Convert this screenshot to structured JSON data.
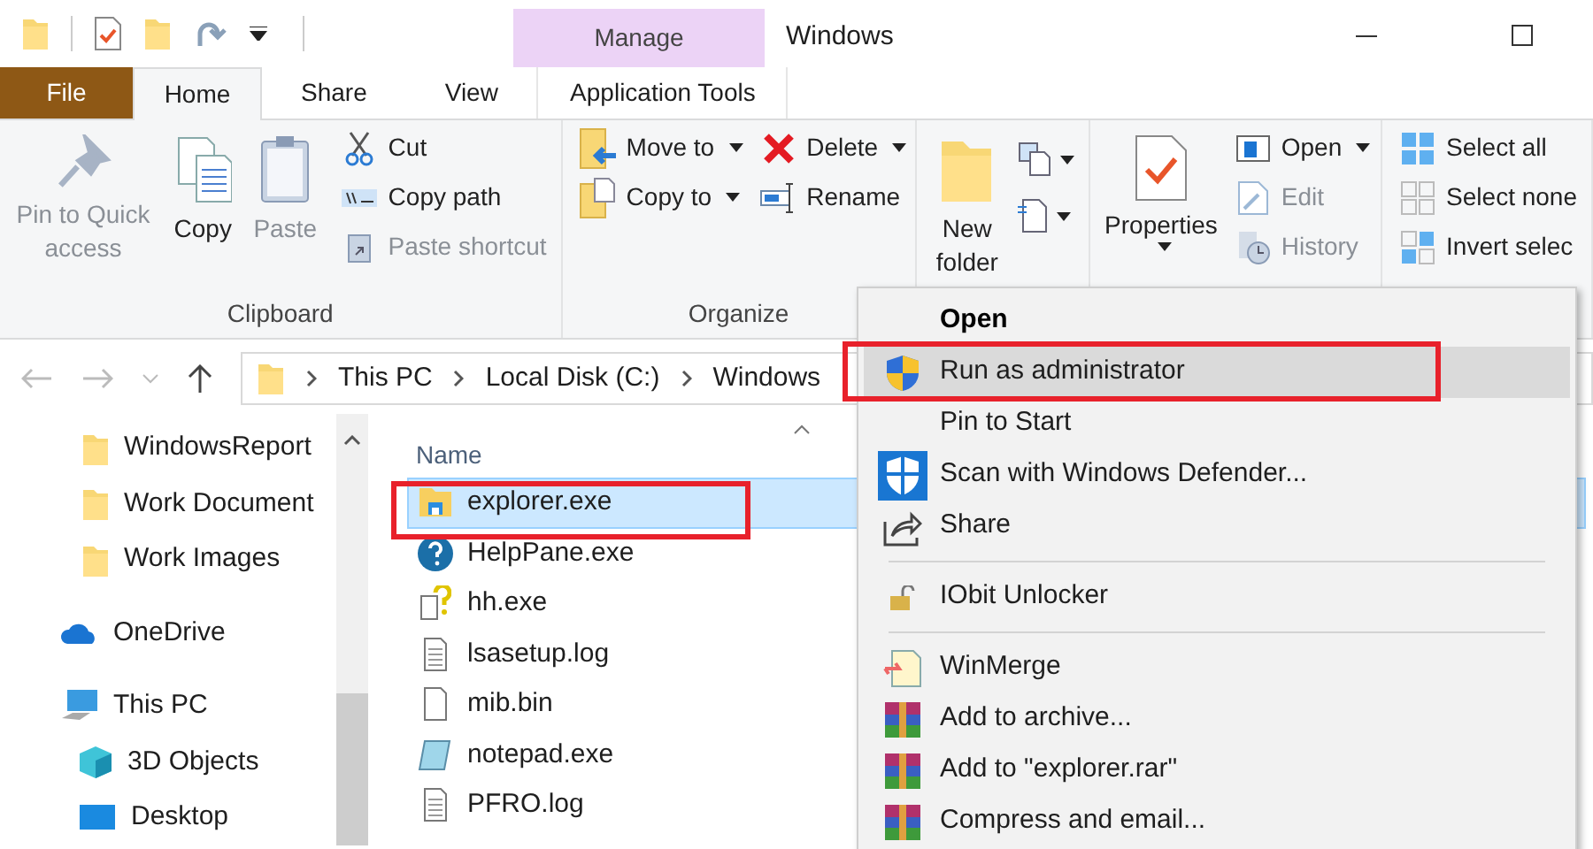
{
  "window": {
    "title": "Windows"
  },
  "contextual_tab": {
    "group": "Manage",
    "label": "Application Tools"
  },
  "file_tab": {
    "label": "File"
  },
  "tabs": [
    {
      "label": "Home",
      "selected": true
    },
    {
      "label": "Share",
      "selected": false
    },
    {
      "label": "View",
      "selected": false
    }
  ],
  "ribbon_groups": [
    {
      "label": "Clipboard",
      "items": [
        {
          "kind": "large",
          "label": "Pin to Quick access",
          "disabled": true
        },
        {
          "kind": "large",
          "label": "Copy",
          "disabled": false
        },
        {
          "kind": "large",
          "label": "Paste",
          "disabled": true
        },
        {
          "kind": "column",
          "items": [
            {
              "label": "Cut",
              "disabled": false
            },
            {
              "label": "Copy path",
              "disabled": false
            },
            {
              "label": "Paste shortcut",
              "disabled": true
            }
          ]
        }
      ]
    },
    {
      "label": "Organize",
      "items": [
        {
          "kind": "column",
          "items": [
            {
              "label": "Move to",
              "dropdown": true,
              "disabled": false
            },
            {
              "label": "Copy to",
              "dropdown": true,
              "disabled": false
            }
          ]
        },
        {
          "kind": "column",
          "items": [
            {
              "label": "Delete",
              "dropdown": true,
              "disabled": false
            },
            {
              "label": "Rename",
              "disabled": false
            }
          ]
        }
      ]
    },
    {
      "items": [
        {
          "kind": "large",
          "label": "New folder",
          "disabled": false
        },
        {
          "kind": "icons"
        }
      ]
    },
    {
      "items": [
        {
          "kind": "large",
          "label": "Properties",
          "dropdown": true,
          "disabled": false
        },
        {
          "kind": "column",
          "items": [
            {
              "label": "Open",
              "dropdown": true,
              "disabled": false
            },
            {
              "label": "Edit",
              "disabled": true
            },
            {
              "label": "History",
              "disabled": true
            }
          ]
        }
      ]
    },
    {
      "items": [
        {
          "kind": "column",
          "items": [
            {
              "label": "Select all",
              "disabled": false
            },
            {
              "label": "Select none",
              "disabled": false
            },
            {
              "label": "Invert selec",
              "disabled": false
            }
          ]
        }
      ]
    }
  ],
  "address": {
    "path": [
      "This PC",
      "Local Disk (C:)",
      "Windows"
    ]
  },
  "navigation": [
    {
      "label": "WindowsReport",
      "kind": "folder"
    },
    {
      "label": "Work Document",
      "kind": "folder"
    },
    {
      "label": "Work Images",
      "kind": "folder"
    },
    {
      "label": "OneDrive",
      "kind": "cloud"
    },
    {
      "label": "This PC",
      "kind": "pc",
      "children": [
        {
          "label": "3D Objects",
          "kind": "cube"
        },
        {
          "label": "Desktop",
          "kind": "desktop"
        }
      ]
    }
  ],
  "file_list": {
    "columns": [
      "Name"
    ],
    "rows": [
      {
        "name": "explorer.exe",
        "selected": true
      },
      {
        "name": "HelpPane.exe",
        "selected": false
      },
      {
        "name": "hh.exe",
        "selected": false
      },
      {
        "name": "lsasetup.log",
        "selected": false
      },
      {
        "name": "mib.bin",
        "selected": false
      },
      {
        "name": "notepad.exe",
        "selected": false
      },
      {
        "name": "PFRO.log",
        "selected": false
      }
    ]
  },
  "context_menu": {
    "groups": [
      [
        {
          "label": "Open",
          "default": true,
          "selected": false
        },
        {
          "label": "Run as administrator",
          "default": false,
          "selected": true
        },
        {
          "label": "Pin to Start",
          "default": false,
          "selected": false
        },
        {
          "label": "Scan with Windows Defender...",
          "default": false,
          "selected": false
        },
        {
          "label": "Share",
          "default": false,
          "selected": false
        }
      ],
      [
        {
          "label": "IObit Unlocker",
          "default": false,
          "selected": false
        }
      ],
      [
        {
          "label": "WinMerge",
          "default": false,
          "selected": false
        },
        {
          "label": "Add to archive...",
          "default": false,
          "selected": false
        },
        {
          "label": "Add to \"explorer.rar\"",
          "default": false,
          "selected": false
        },
        {
          "label": "Compress and email...",
          "default": false,
          "selected": false
        }
      ]
    ]
  }
}
